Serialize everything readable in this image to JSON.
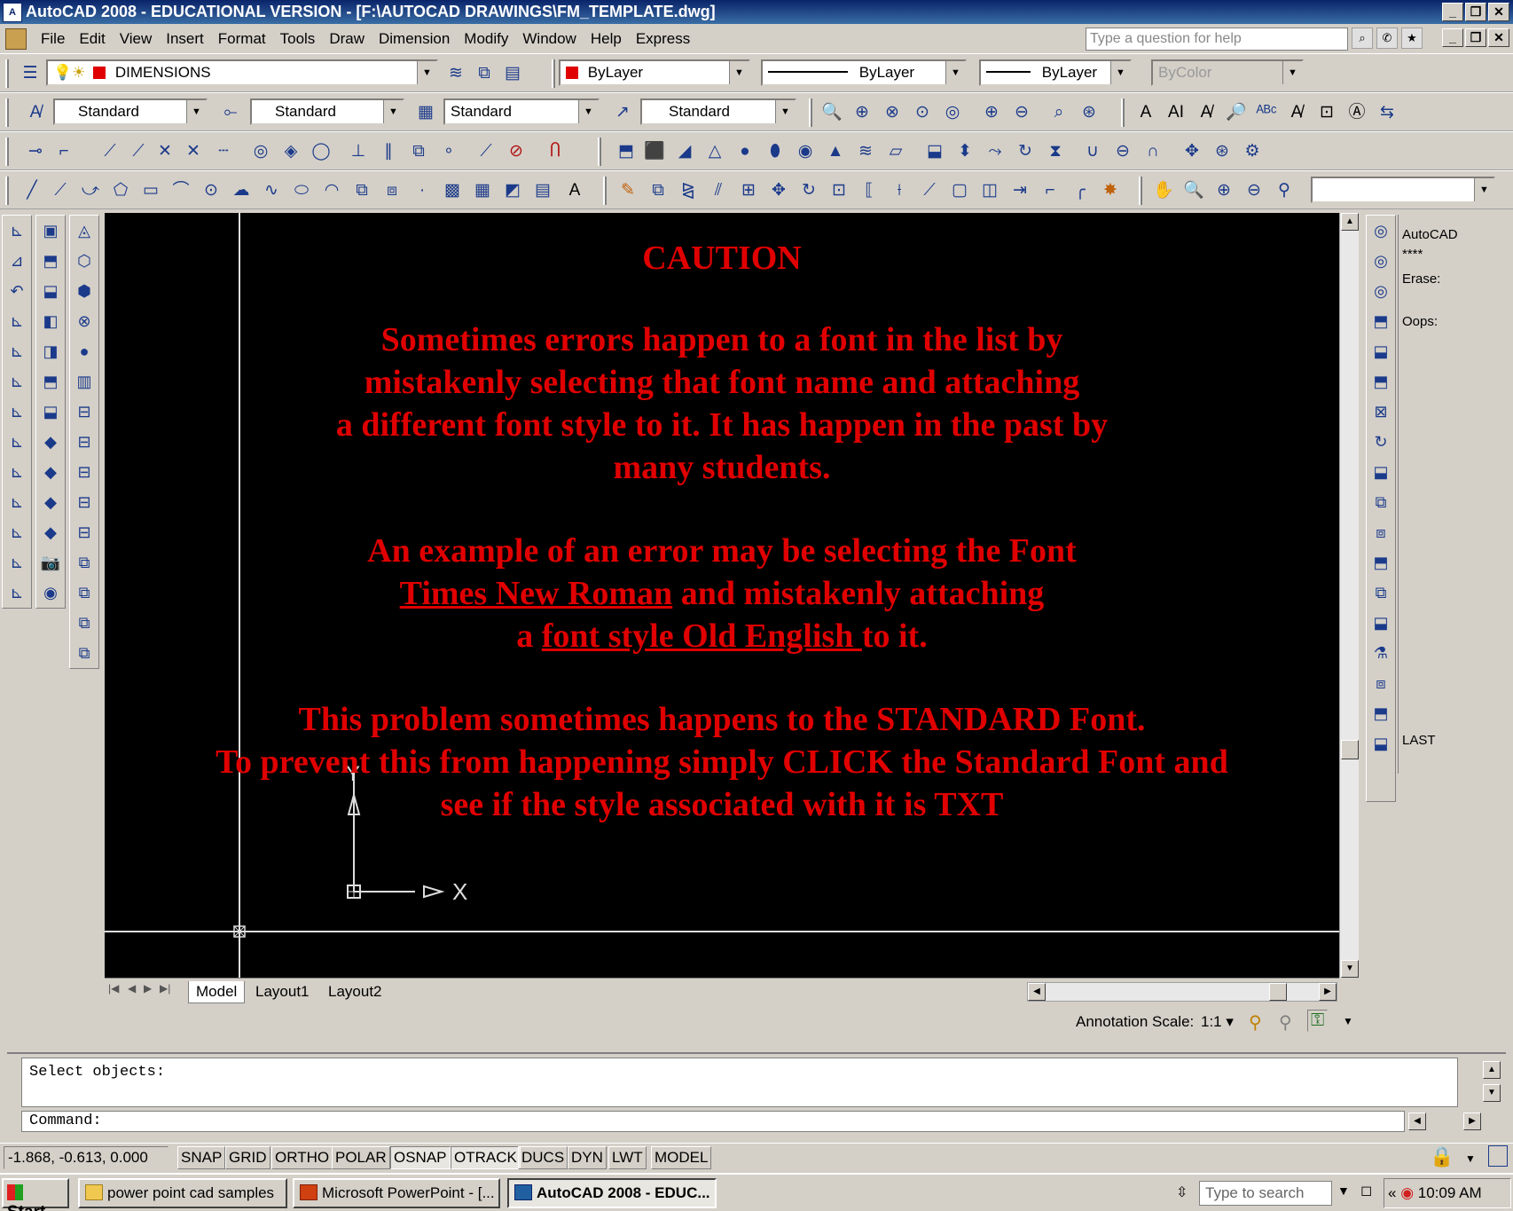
{
  "window": {
    "title": "AutoCAD 2008 - EDUCATIONAL VERSION - [F:\\AUTOCAD DRAWINGS\\FM_TEMPLATE.dwg]"
  },
  "menu": {
    "items": [
      "File",
      "Edit",
      "View",
      "Insert",
      "Format",
      "Tools",
      "Draw",
      "Dimension",
      "Modify",
      "Window",
      "Help",
      "Express"
    ],
    "help_placeholder": "Type a question for help"
  },
  "layers": {
    "current_layer": "DIMENSIONS",
    "color": "ByLayer",
    "linetype": "ByLayer",
    "lineweight": "ByLayer",
    "plotstyle": "ByColor"
  },
  "styles": {
    "text_style": "Standard",
    "dim_style": "Standard",
    "table_style": "Standard",
    "multileader_style": "Standard"
  },
  "caution": {
    "heading": "CAUTION",
    "p1_l1": "Sometimes errors happen to a font in the list by",
    "p1_l2": "mistakenly selecting that font name  and attaching",
    "p1_l3": "a different font style to it.  It has happen in the past by",
    "p1_l4": "many students.",
    "p2_l1": "An example of an  error may be selecting the Font",
    "p2_l2_u": "Times New Roman",
    "p2_l2_rest": " and mistakenly attaching",
    "p2_l3_pre": "a ",
    "p2_l3_u": "font style Old English ",
    "p2_l3_rest": "to it.",
    "p3_l1": "This problem sometimes happens to the STANDARD Font.",
    "p3_l2": "To prevent this from happening simply CLICK the Standard Font and",
    "p3_l3": "see if the style associated with it  is TXT"
  },
  "ucs": {
    "x_label": "X",
    "y_label": "Y"
  },
  "layout_tabs": [
    "Model",
    "Layout1",
    "Layout2"
  ],
  "properties_panel": {
    "line1": "AutoCAD",
    "line2": "****",
    "line3": "Erase:",
    "line4": "Oops:",
    "line5": "LAST"
  },
  "annotation": {
    "label": "Annotation Scale:",
    "value": "1:1"
  },
  "command": {
    "history": "Select objects:",
    "prompt": "Command:"
  },
  "status": {
    "coords": "-1.868, -0.613, 0.000",
    "toggles": [
      "SNAP",
      "GRID",
      "ORTHO",
      "POLAR",
      "OSNAP",
      "OTRACK",
      "DUCS",
      "DYN",
      "LWT",
      "MODEL"
    ]
  },
  "taskbar": {
    "start": "Start",
    "task1": "power point cad samples",
    "task2": "Microsoft PowerPoint - [...",
    "task3": "AutoCAD 2008 - EDUC...",
    "search_placeholder": "Type to search",
    "clock": "10:09 AM"
  },
  "colors": {
    "caution_text": "#e00000",
    "canvas_bg": "#000000",
    "titlebar": "#0a246a"
  }
}
